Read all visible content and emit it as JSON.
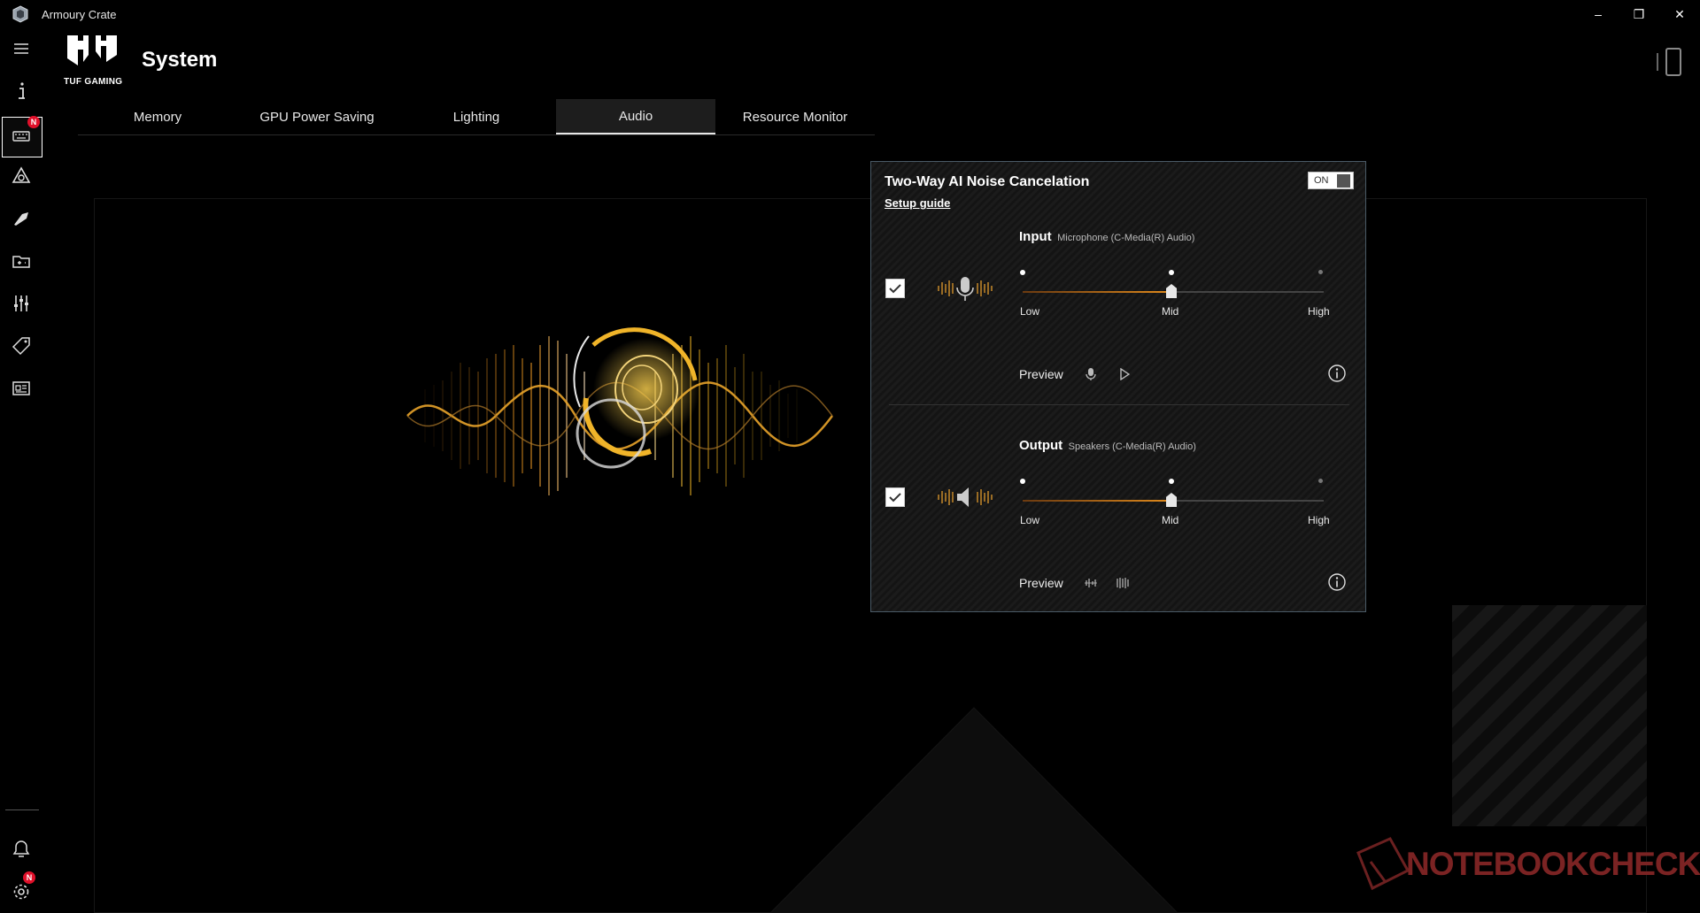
{
  "window": {
    "title": "Armoury Crate"
  },
  "header": {
    "brand": "TUF GAMING",
    "title": "System"
  },
  "tabs": [
    {
      "label": "Memory"
    },
    {
      "label": "GPU Power Saving"
    },
    {
      "label": "Lighting"
    },
    {
      "label": "Audio",
      "active": true
    },
    {
      "label": "Resource Monitor"
    }
  ],
  "sidebar": {
    "items": [
      {
        "icon": "menu-icon"
      },
      {
        "icon": "info-icon"
      },
      {
        "icon": "device-icon",
        "badge": "N",
        "active": true
      },
      {
        "icon": "aura-icon"
      },
      {
        "icon": "scenario-icon"
      },
      {
        "icon": "game-library-icon"
      },
      {
        "icon": "settings-sliders-icon"
      },
      {
        "icon": "deals-tag-icon"
      },
      {
        "icon": "news-icon"
      }
    ],
    "bottom": [
      {
        "icon": "user-icon"
      },
      {
        "icon": "gear-icon",
        "badge": "N"
      }
    ]
  },
  "noise_panel": {
    "title": "Two-Way AI Noise Cancelation",
    "setup_guide": "Setup guide",
    "toggle": "ON",
    "input": {
      "label": "Input",
      "device": "Microphone (C-Media(R) Audio)",
      "checked": true,
      "level": "Mid",
      "levels": [
        "Low",
        "Mid",
        "High"
      ],
      "preview": "Preview"
    },
    "output": {
      "label": "Output",
      "device": "Speakers (C-Media(R) Audio)",
      "checked": true,
      "level": "Mid",
      "levels": [
        "Low",
        "Mid",
        "High"
      ],
      "preview": "Preview"
    }
  },
  "watermark": "NOTEBOOKCHECK",
  "colors": {
    "accent": "#e08a1c",
    "badge": "#e0102a",
    "watermark": "#7b2323"
  }
}
